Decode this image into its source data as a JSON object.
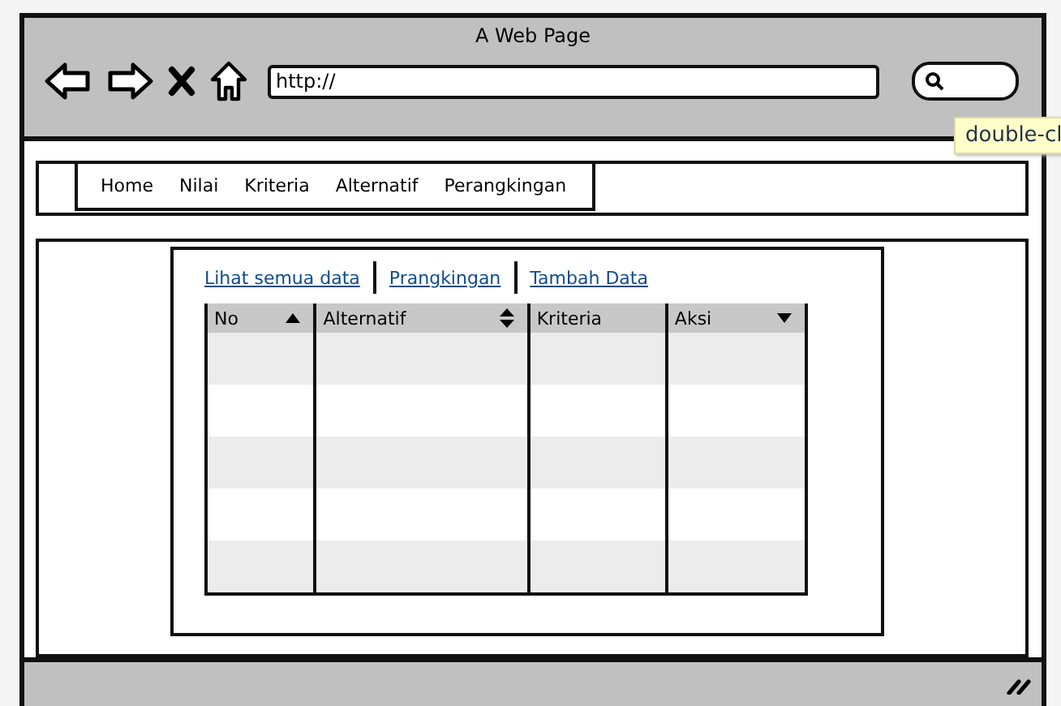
{
  "window": {
    "title": "A Web Page"
  },
  "address_bar": {
    "value": "http://"
  },
  "tooltip": {
    "text": "double-cl"
  },
  "nav": {
    "items": [
      {
        "label": "Home"
      },
      {
        "label": "Nilai"
      },
      {
        "label": "Kriteria"
      },
      {
        "label": "Alternatif"
      },
      {
        "label": "Perangkingan"
      }
    ]
  },
  "links": [
    {
      "label": "Lihat semua data"
    },
    {
      "label": "Prangkingan"
    },
    {
      "label": "Tambah Data"
    }
  ],
  "table": {
    "columns": [
      {
        "label": "No",
        "kind": "sort-up"
      },
      {
        "label": "Alternatif",
        "kind": "sortable"
      },
      {
        "label": "Kriteria",
        "kind": "plain"
      },
      {
        "label": "Aksi",
        "kind": "dropdown"
      }
    ]
  }
}
